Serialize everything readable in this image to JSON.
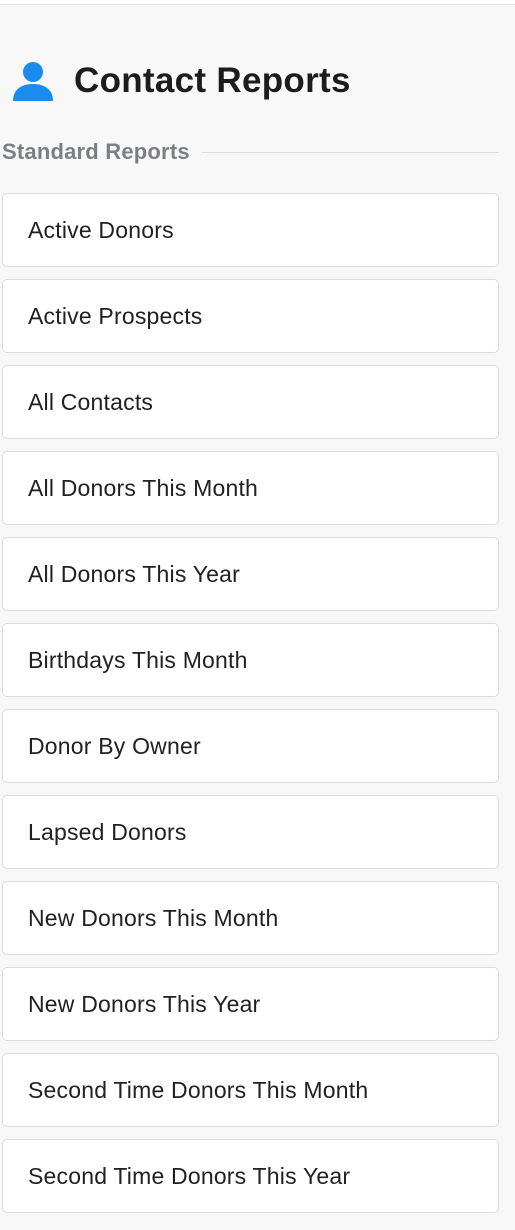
{
  "header": {
    "title": "Contact Reports",
    "icon": "person-icon",
    "icon_color": "#1a8cf0"
  },
  "section": {
    "label": "Standard Reports"
  },
  "reports": [
    {
      "label": "Active Donors"
    },
    {
      "label": "Active Prospects"
    },
    {
      "label": "All Contacts"
    },
    {
      "label": "All Donors This Month"
    },
    {
      "label": "All Donors This Year"
    },
    {
      "label": "Birthdays This Month"
    },
    {
      "label": "Donor By Owner"
    },
    {
      "label": "Lapsed Donors"
    },
    {
      "label": "New Donors This Month"
    },
    {
      "label": "New Donors This Year"
    },
    {
      "label": "Second Time Donors This Month"
    },
    {
      "label": "Second Time Donors This Year"
    }
  ]
}
